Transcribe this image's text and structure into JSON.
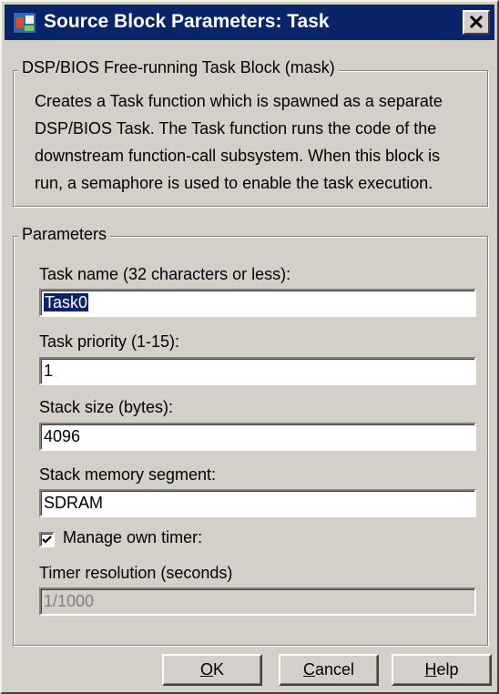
{
  "window": {
    "title": "Source Block Parameters: Task",
    "close_glyph": "close-icon"
  },
  "description_group": {
    "legend": "DSP/BIOS Free-running Task Block (mask)",
    "text": "Creates a Task function which is spawned as a separate DSP/BIOS Task. The Task function runs the code of the downstream function-call subsystem. When this block is run, a semaphore is used to enable the task execution."
  },
  "parameters_group": {
    "legend": "Parameters",
    "task_name": {
      "label": "Task name (32 characters or less):",
      "value": "Task0"
    },
    "task_priority": {
      "label": "Task priority (1-15):",
      "value": "1"
    },
    "stack_size": {
      "label": "Stack size (bytes):",
      "value": "4096"
    },
    "stack_memory_segment": {
      "label": "Stack memory segment:",
      "value": "SDRAM"
    },
    "manage_own_timer": {
      "label": "Manage own timer:",
      "checked": true
    },
    "timer_resolution": {
      "label": "Timer resolution (seconds)",
      "value": "1/1000",
      "disabled": true
    }
  },
  "buttons": {
    "ok": {
      "mnemonic": "O",
      "rest": "K"
    },
    "cancel": {
      "mnemonic": "C",
      "rest": "ancel"
    },
    "help": {
      "mnemonic": "H",
      "rest": "elp"
    }
  },
  "colors": {
    "title_bar": "#0a246a",
    "dialog_face": "#d4d0c8",
    "selection": "#0a246a"
  }
}
